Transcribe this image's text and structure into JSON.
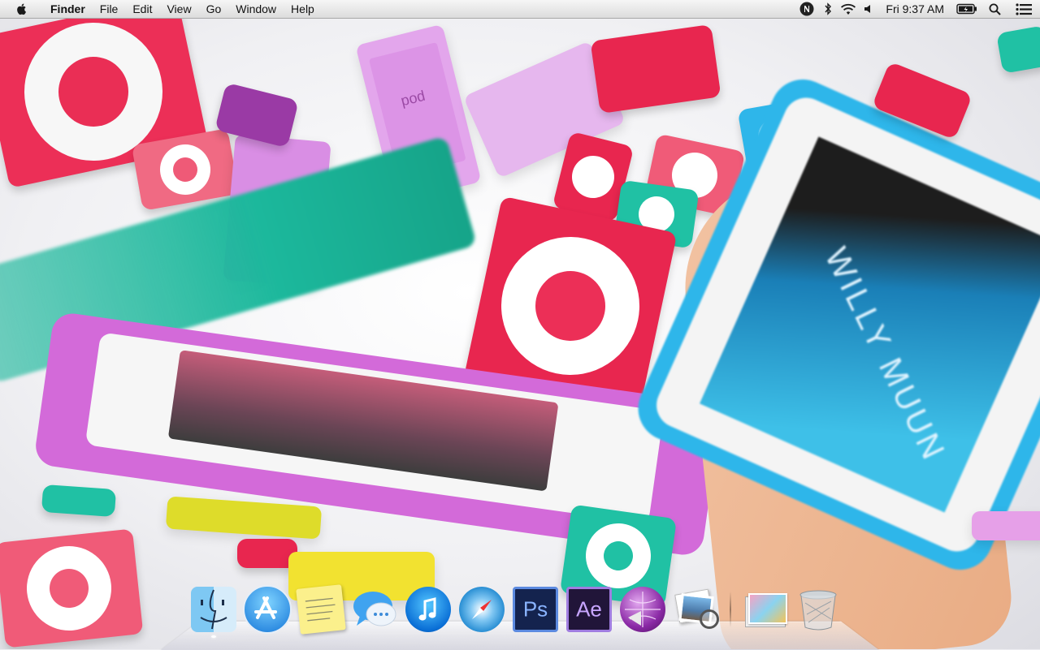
{
  "menubar": {
    "apple_icon": "apple-logo-icon",
    "app_name": "Finder",
    "menus": [
      "File",
      "Edit",
      "View",
      "Go",
      "Window",
      "Help"
    ],
    "status_icons": [
      "notifications-n-icon",
      "bluetooth-icon",
      "wifi-icon",
      "volume-icon"
    ],
    "clock": "Fri 9:37 AM",
    "battery_icon": "battery-charging-icon",
    "spotlight_icon": "spotlight-search-icon",
    "notification_center_icon": "notification-center-list-icon"
  },
  "wallpaper": {
    "text": "WILLY MUUN",
    "brand_text": "pod"
  },
  "dock": {
    "apps": [
      {
        "name": "Finder",
        "icon": "finder-icon",
        "running": true
      },
      {
        "name": "App Store",
        "icon": "app-store-icon",
        "running": false
      },
      {
        "name": "Stickies",
        "icon": "stickies-icon",
        "running": false
      },
      {
        "name": "Messages",
        "icon": "messages-icon",
        "running": false
      },
      {
        "name": "iTunes",
        "icon": "itunes-icon",
        "running": false
      },
      {
        "name": "Safari",
        "icon": "safari-icon",
        "running": false
      },
      {
        "name": "Photoshop",
        "icon": "photoshop-icon",
        "label": "Ps",
        "running": false
      },
      {
        "name": "After Effects",
        "icon": "after-effects-icon",
        "label": "Ae",
        "running": false
      },
      {
        "name": "Speech/Podcast",
        "icon": "purple-globe-megaphone-icon",
        "running": false
      },
      {
        "name": "Preview",
        "icon": "preview-icon",
        "running": false
      }
    ],
    "stacks": [
      {
        "name": "Documents",
        "icon": "documents-stack-icon"
      },
      {
        "name": "Trash",
        "icon": "trash-icon"
      }
    ]
  },
  "colors": {
    "shuffle_red": "#e8264f",
    "shuffle_pink": "#ee4d6e",
    "teal": "#1cb89c",
    "purple": "#cf6ad6",
    "blue": "#2eb6ea",
    "ps_blue": "#2a3f8c",
    "ae_purple": "#37215b"
  }
}
